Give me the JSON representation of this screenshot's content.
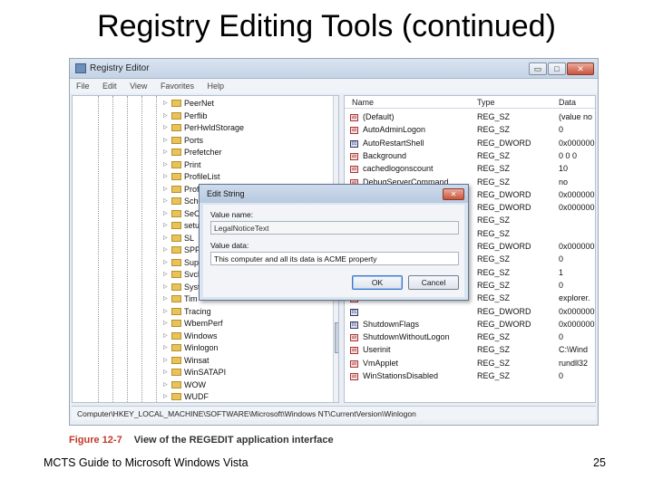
{
  "slide": {
    "title": "Registry Editing Tools (continued)",
    "footer": "MCTS Guide to Microsoft Windows Vista",
    "page_number": "25"
  },
  "figure": {
    "label": "Figure 12-7",
    "caption": "View of the REGEDIT application interface"
  },
  "window": {
    "title": "Registry Editor",
    "menu": [
      "File",
      "Edit",
      "View",
      "Favorites",
      "Help"
    ],
    "controls": {
      "minimize": "▭",
      "maximize": "□",
      "close": "✕"
    }
  },
  "tree": {
    "items": [
      "PeerNet",
      "Perflib",
      "PerHwIdStorage",
      "Ports",
      "Prefetcher",
      "Print",
      "ProfileList",
      "Prof",
      "Sche",
      "SeC",
      "setu",
      "SL",
      "SPP",
      "Sup",
      "Svch",
      "Syst",
      "Tim",
      "Tracing",
      "WbemPerf",
      "Windows",
      "Winlogon",
      "Winsat",
      "WinSATAPI",
      "WOW",
      "WUDF"
    ]
  },
  "list": {
    "columns": [
      "Name",
      "Type",
      "Data"
    ],
    "rows": [
      {
        "name": "(Default)",
        "type": "REG_SZ",
        "data": "(value no",
        "kind": "sz"
      },
      {
        "name": "AutoAdminLogon",
        "type": "REG_SZ",
        "data": "0",
        "kind": "sz"
      },
      {
        "name": "AutoRestartShell",
        "type": "REG_DWORD",
        "data": "0x000000",
        "kind": "dw"
      },
      {
        "name": "Background",
        "type": "REG_SZ",
        "data": "0 0 0",
        "kind": "sz"
      },
      {
        "name": "cachedlogonscount",
        "type": "REG_SZ",
        "data": "10",
        "kind": "sz"
      },
      {
        "name": "DebugServerCommand",
        "type": "REG_SZ",
        "data": "no",
        "kind": "sz"
      },
      {
        "name": "",
        "type": "REG_DWORD",
        "data": "0x000000",
        "kind": "dw"
      },
      {
        "name": "",
        "type": "REG_DWORD",
        "data": "0x000000",
        "kind": "dw"
      },
      {
        "name": "",
        "type": "REG_SZ",
        "data": "",
        "kind": "sz"
      },
      {
        "name": "",
        "type": "REG_SZ",
        "data": "",
        "kind": "sz"
      },
      {
        "name": "",
        "type": "REG_DWORD",
        "data": "0x000000",
        "kind": "dw"
      },
      {
        "name": "",
        "type": "REG_SZ",
        "data": "0",
        "kind": "sz"
      },
      {
        "name": "",
        "type": "REG_SZ",
        "data": "1",
        "kind": "sz"
      },
      {
        "name": "",
        "type": "REG_SZ",
        "data": "0",
        "kind": "sz"
      },
      {
        "name": "",
        "type": "REG_SZ",
        "data": "explorer.",
        "kind": "sz"
      },
      {
        "name": "",
        "type": "REG_DWORD",
        "data": "0x000000",
        "kind": "dw"
      },
      {
        "name": "ShutdownFlags",
        "type": "REG_DWORD",
        "data": "0x000000",
        "kind": "dw"
      },
      {
        "name": "ShutdownWithoutLogon",
        "type": "REG_SZ",
        "data": "0",
        "kind": "sz"
      },
      {
        "name": "Userinit",
        "type": "REG_SZ",
        "data": "C:\\Wind",
        "kind": "sz"
      },
      {
        "name": "VmApplet",
        "type": "REG_SZ",
        "data": "rundll32",
        "kind": "sz"
      },
      {
        "name": "WinStationsDisabled",
        "type": "REG_SZ",
        "data": "0",
        "kind": "sz"
      }
    ]
  },
  "status_path": "Computer\\HKEY_LOCAL_MACHINE\\SOFTWARE\\Microsoft\\Windows NT\\CurrentVersion\\Winlogon",
  "dialog": {
    "title": "Edit String",
    "close": "✕",
    "value_name_label": "Value name:",
    "value_name": "LegalNoticeText",
    "value_data_label": "Value data:",
    "value_data": "This computer and all its data is ACME property",
    "ok_label": "OK",
    "cancel_label": "Cancel"
  }
}
